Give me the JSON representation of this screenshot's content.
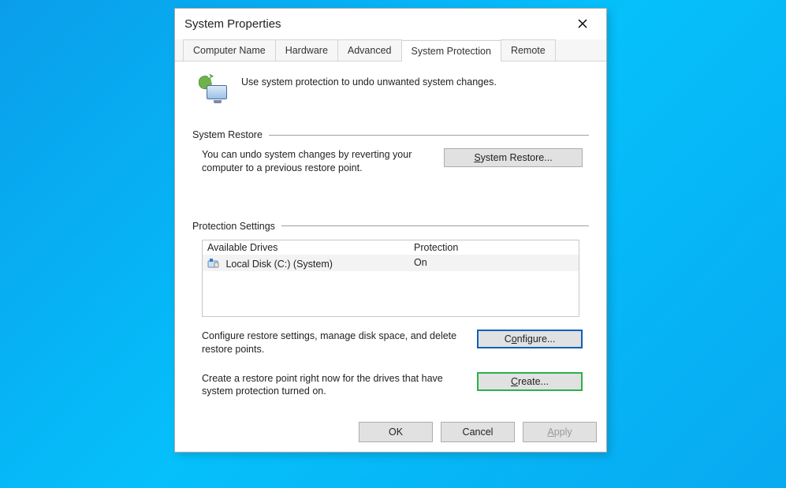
{
  "window": {
    "title": "System Properties"
  },
  "tabs": {
    "items": [
      "Computer Name",
      "Hardware",
      "Advanced",
      "System Protection",
      "Remote"
    ],
    "active": "System Protection"
  },
  "intro": {
    "text": "Use system protection to undo unwanted system changes."
  },
  "restore": {
    "heading": "System Restore",
    "desc": "You can undo system changes by reverting your computer to a previous restore point.",
    "button_prefix": "",
    "button_ul": "S",
    "button_rest": "ystem Restore..."
  },
  "settings": {
    "heading": "Protection Settings",
    "columns": {
      "c1": "Available Drives",
      "c2": "Protection"
    },
    "rows": [
      {
        "drive": "Local Disk (C:) (System)",
        "protection": "On"
      }
    ],
    "configure_desc": "Configure restore settings, manage disk space, and delete restore points.",
    "configure_prefix": "C",
    "configure_ul": "o",
    "configure_rest": "nfigure...",
    "create_desc": "Create a restore point right now for the drives that have system protection turned on.",
    "create_prefix": "",
    "create_ul": "C",
    "create_rest": "reate..."
  },
  "footer": {
    "ok": "OK",
    "cancel": "Cancel",
    "apply_prefix": "",
    "apply_ul": "A",
    "apply_rest": "pply"
  }
}
